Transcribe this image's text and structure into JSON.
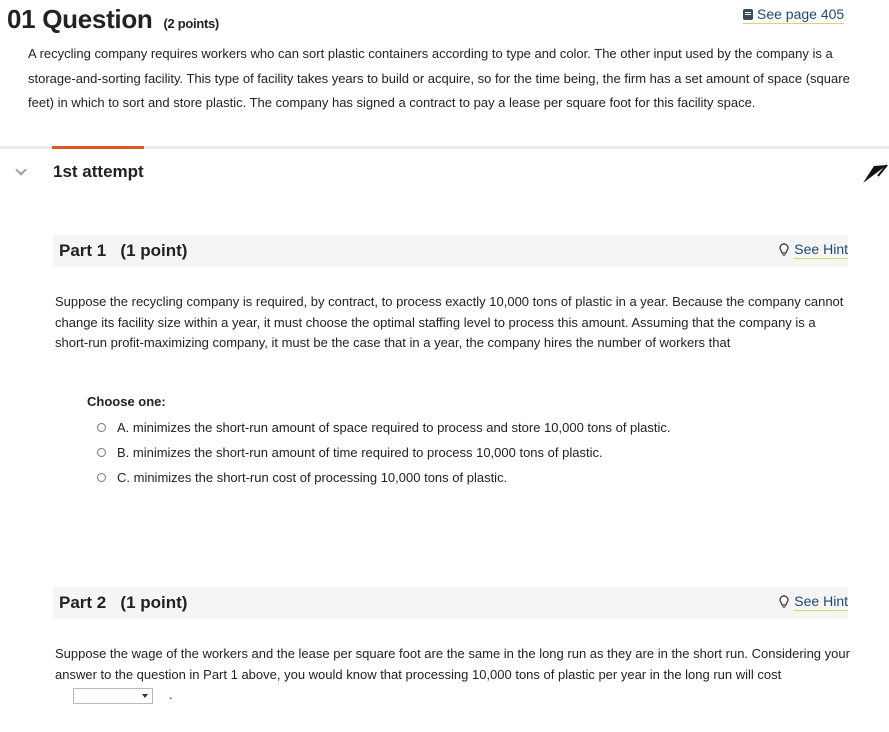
{
  "question": {
    "number_title": "01 Question",
    "points": "(2 points)",
    "see_page": "See page 405",
    "text": "A recycling company requires workers who can sort plastic containers according to type and color. The other input used by the company is a storage-and-sorting facility. This type of facility takes years to build or acquire, so for the time being, the firm has a set amount of space (square feet) in which to sort and store plastic. The company has signed a contract to pay a lease per square foot for this facility space."
  },
  "attempt": {
    "label": "1st attempt"
  },
  "part1": {
    "title": "Part 1   (1 point)",
    "hint": "See Hint",
    "text": "Suppose the recycling company is required, by contract, to process exactly 10,000 tons of plastic in a year. Because the company cannot change its facility size within a year, it must choose the optimal staffing level to process this amount. Assuming that the company is a short-run profit-maximizing company, it must be the case that in a year, the company hires the number of workers that",
    "choose_label": "Choose one:",
    "options": [
      "A. minimizes the short-run amount of space required to process and store 10,000 tons of plastic.",
      "B. minimizes the short-run amount of time required to process 10,000 tons of plastic.",
      "C. minimizes the short-run cost of processing 10,000 tons of plastic."
    ]
  },
  "part2": {
    "title": "Part 2   (1 point)",
    "hint": "See Hint",
    "text": "Suppose the wage of the workers and the lease per square foot are the same in the long run as they are in the short run. Considering your answer to the question in Part 1 above, you would know that processing 10,000 tons of plastic per year in the long run will cost",
    "end_punct": "."
  }
}
